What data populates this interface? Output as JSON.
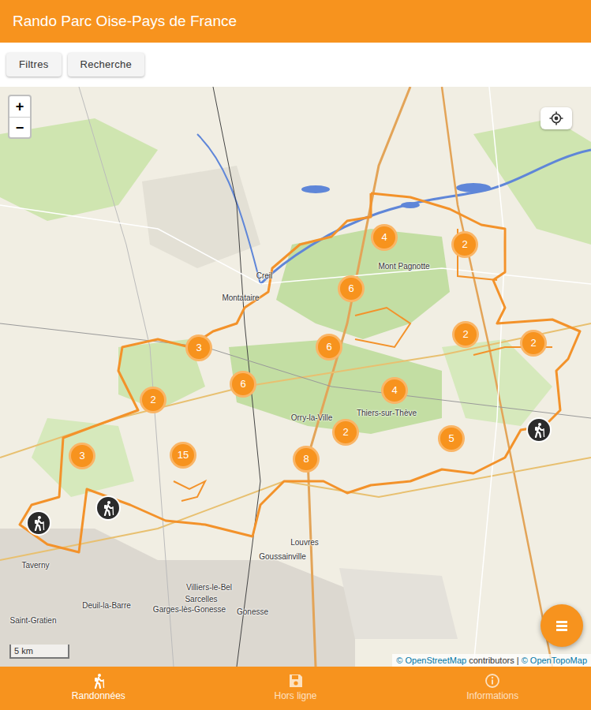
{
  "app_bar": {
    "title": "Rando Parc Oise-Pays de France"
  },
  "toolbar": {
    "buttons": [
      "Filtres",
      "Recherche"
    ]
  },
  "map": {
    "zoom_in": "+",
    "zoom_out": "−",
    "clusters": [
      {
        "count": "4"
      },
      {
        "count": "2"
      },
      {
        "count": "6"
      },
      {
        "count": "3"
      },
      {
        "count": "6"
      },
      {
        "count": "2"
      },
      {
        "count": "2"
      },
      {
        "count": "6"
      },
      {
        "count": "4"
      },
      {
        "count": "2"
      },
      {
        "count": "2"
      },
      {
        "count": "5"
      },
      {
        "count": "3"
      },
      {
        "count": "15"
      },
      {
        "count": "8"
      }
    ],
    "hikes": [
      {
        "kind": "single"
      },
      {
        "kind": "single"
      },
      {
        "kind": "single"
      }
    ],
    "labels": [
      "Creil",
      "Montataire",
      "Mont Pagnotte",
      "Orry-la-Ville",
      "Thiers-sur-Thève",
      "Louvres",
      "Goussainville",
      "Villiers-le-Bel",
      "Sarcelles",
      "Garges-lès-Gonesse",
      "Gonesse",
      "Deuil-la-Barre",
      "Taverny",
      "Saint-Gratien"
    ],
    "scale": "5 km",
    "attribution": [
      {
        "text": "© OpenStreetMap",
        "link": true
      },
      {
        "text": "contributors |",
        "link": false
      },
      {
        "text": "© OpenTopoMap",
        "link": true
      }
    ]
  },
  "bottom_nav": [
    {
      "label": "Randonnées",
      "selected": true
    },
    {
      "label": "Hors ligne",
      "selected": false
    },
    {
      "label": "Informations",
      "selected": false
    }
  ]
}
